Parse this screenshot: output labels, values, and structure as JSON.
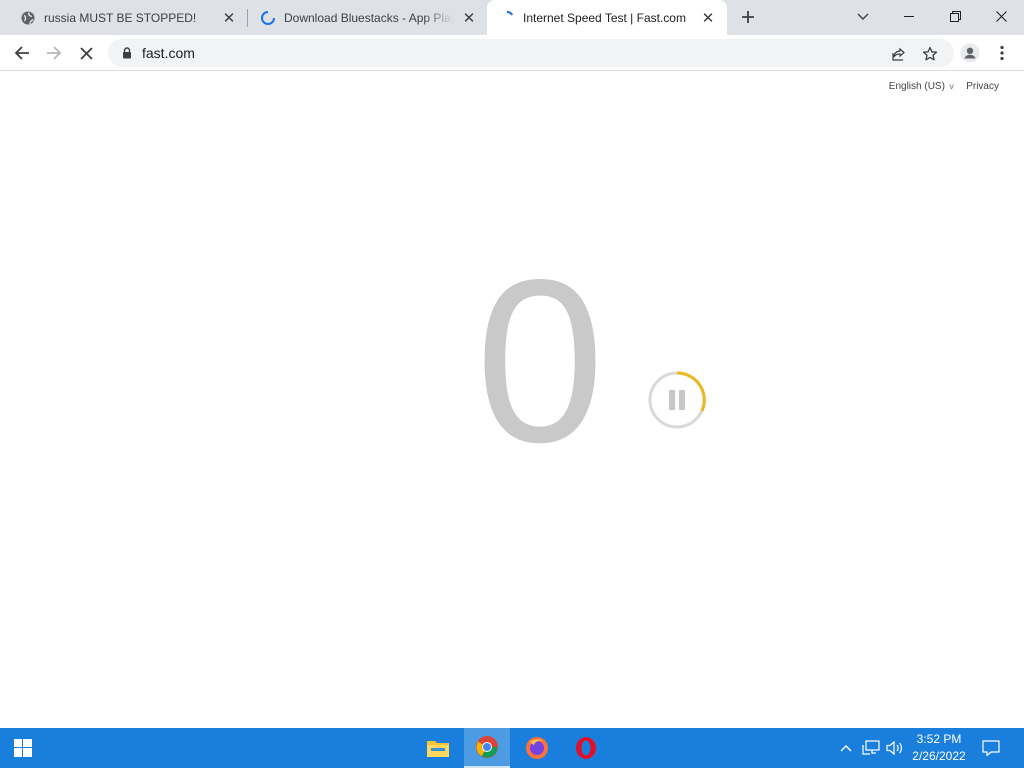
{
  "tabs": [
    {
      "title": "russia MUST BE STOPPED!",
      "favicon": "globe-icon",
      "active": false
    },
    {
      "title": "Download Bluestacks - App Player",
      "favicon": "loading-spinner-icon",
      "active": false
    },
    {
      "title": "Internet Speed Test | Fast.com",
      "favicon": "loading-spinner-icon",
      "active": true
    }
  ],
  "window_controls": [
    "tab-search-icon",
    "minimize-icon",
    "restore-icon",
    "close-icon"
  ],
  "toolbar": {
    "url": "fast.com",
    "buttons": [
      "back-arrow-icon",
      "forward-arrow-icon",
      "stop-loading-icon",
      "share-icon",
      "bookmark-star-icon",
      "profile-icon",
      "kebab-menu-icon"
    ]
  },
  "page": {
    "language": "English (US)",
    "privacy": "Privacy",
    "speed_value": "0",
    "accent_color": "#e9b81d"
  },
  "taskbar": {
    "pinned": [
      "file-explorer-icon",
      "chrome-icon",
      "firefox-icon",
      "opera-icon"
    ],
    "time": "3:52 PM",
    "date": "2/26/2022",
    "color": "#1a7fdc"
  }
}
